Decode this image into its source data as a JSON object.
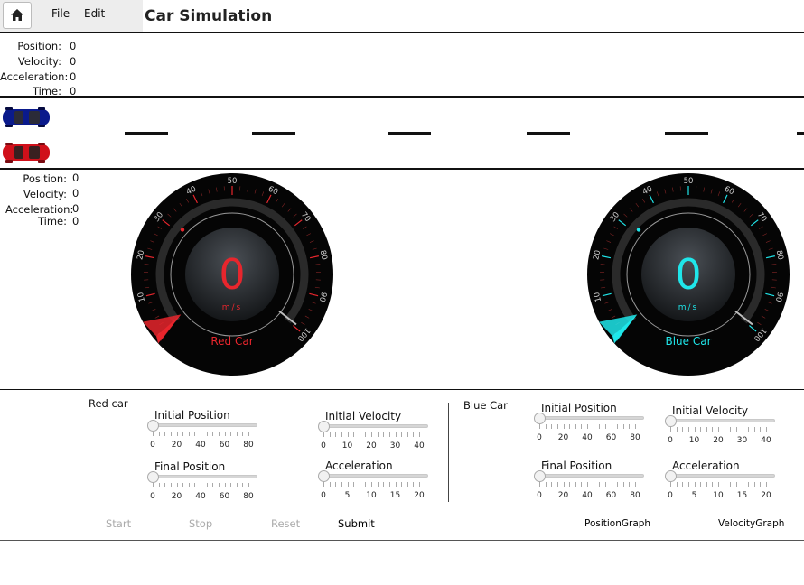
{
  "app": {
    "title": "Car Simulation",
    "menu": [
      "File",
      "Edit"
    ]
  },
  "top_stats": {
    "labels": [
      "Position:",
      "Velocity:",
      "Acceleration:",
      "Time:"
    ],
    "values": [
      "0",
      "0",
      "0",
      "0"
    ]
  },
  "bottom_stats": {
    "labels": [
      "Position:",
      "Velocity:",
      "Acceleration:",
      "Time:"
    ],
    "values": [
      "0",
      "0",
      "0",
      "0"
    ]
  },
  "cars": {
    "blue_color": "#0a1a8c",
    "red_color": "#d0101a"
  },
  "gauges": [
    {
      "name": "Red Car",
      "value": "0",
      "unit": "m/s",
      "accent": "#e8262d",
      "ticks": [
        "0",
        "10",
        "20",
        "30",
        "40",
        "50",
        "60",
        "70",
        "80",
        "90",
        "100"
      ]
    },
    {
      "name": "Blue Car",
      "value": "0",
      "unit": "m/s",
      "accent": "#1fe6ea",
      "ticks": [
        "0",
        "10",
        "20",
        "30",
        "40",
        "50",
        "60",
        "70",
        "80",
        "90",
        "100"
      ]
    }
  ],
  "controls": {
    "red": {
      "header": "Red car",
      "initial_position": {
        "title": "Initial Position",
        "ticks": [
          "0",
          "20",
          "40",
          "60",
          "80"
        ],
        "value": 0
      },
      "final_position": {
        "title": "Final Position",
        "ticks": [
          "0",
          "20",
          "40",
          "60",
          "80"
        ],
        "value": 0
      },
      "initial_velocity": {
        "title": "Initial Velocity",
        "ticks": [
          "0",
          "10",
          "20",
          "30",
          "40"
        ],
        "value": 0
      },
      "acceleration": {
        "title": "Acceleration",
        "ticks": [
          "0",
          "5",
          "10",
          "15",
          "20"
        ],
        "value": 0
      }
    },
    "blue": {
      "header": "Blue Car",
      "initial_position": {
        "title": "Initial Position",
        "ticks": [
          "0",
          "20",
          "40",
          "60",
          "80"
        ],
        "value": 0
      },
      "final_position": {
        "title": "Final Position",
        "ticks": [
          "0",
          "20",
          "40",
          "60",
          "80"
        ],
        "value": 0
      },
      "initial_velocity": {
        "title": "Initial Velocity",
        "ticks": [
          "0",
          "10",
          "20",
          "30",
          "40"
        ],
        "value": 0
      },
      "acceleration": {
        "title": "Acceleration",
        "ticks": [
          "0",
          "5",
          "10",
          "15",
          "20"
        ],
        "value": 0
      }
    }
  },
  "buttons": {
    "start": "Start",
    "stop": "Stop",
    "reset": "Reset",
    "submit": "Submit",
    "position_graph": "PositionGraph",
    "velocity_graph": "VelocityGraph"
  }
}
